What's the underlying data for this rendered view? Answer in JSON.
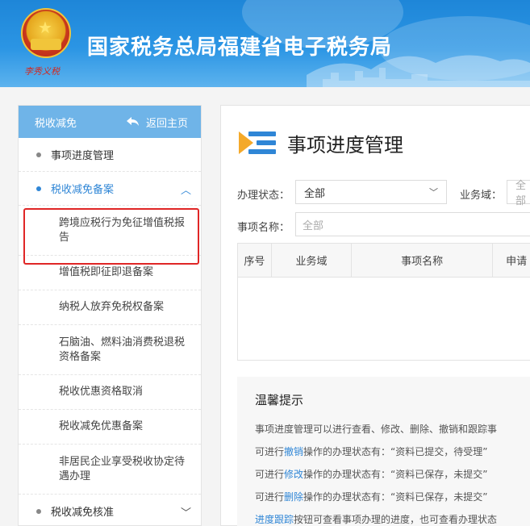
{
  "header": {
    "site_title": "国家税务总局福建省电子税务局",
    "signature": "李秀义税"
  },
  "sidebar": {
    "section_title": "税收减免",
    "back_label": "返回主页",
    "items": [
      {
        "label": "事项进度管理"
      },
      {
        "label": "税收减免备案"
      },
      {
        "label": "税收减免核准"
      }
    ],
    "sub_items": [
      "跨境应税行为免征增值税报告",
      "增值税即征即退备案",
      "纳税人放弃免税权备案",
      "石脑油、燃料油消费税退税资格备案",
      "税收优惠资格取消",
      "税收减免优惠备案",
      "非居民企业享受税收协定待遇办理"
    ]
  },
  "main": {
    "page_title": "事项进度管理",
    "filters": {
      "status_label": "办理状态：",
      "status_value": "全部",
      "domain_label": "业务域：",
      "domain_value": "全部",
      "name_label": "事项名称：",
      "name_placeholder": "全部"
    },
    "table": {
      "columns": [
        "序号",
        "业务域",
        "事项名称",
        "申请"
      ]
    },
    "tips": {
      "title": "温馨提示",
      "line1": "事项进度管理可以进行查看、修改、删除、撤销和跟踪事",
      "line2_pre": "可进行",
      "line2_link": "撤销",
      "line2_post": "操作的办理状态有：“资料已提交，待受理”",
      "line3_pre": "可进行",
      "line3_link": "修改",
      "line3_post": "操作的办理状态有：“资料已保存，未提交”",
      "line4_pre": "可进行",
      "line4_link": "删除",
      "line4_post": "操作的办理状态有：“资料已保存，未提交”",
      "line5_link": "进度跟踪",
      "line5_post": "按钮可查看事项办理的进度，也可查看办理状态"
    }
  }
}
